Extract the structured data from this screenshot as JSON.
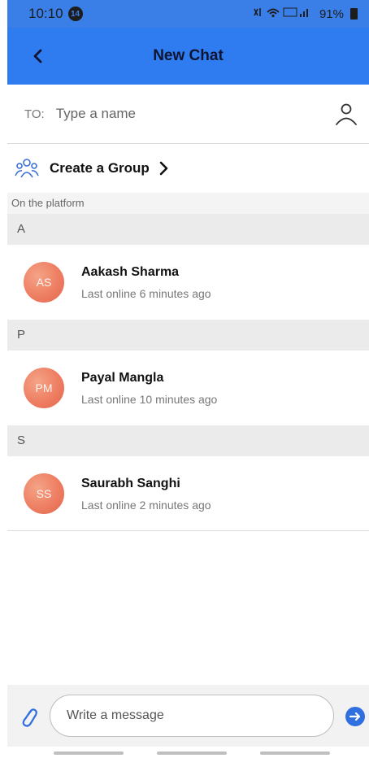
{
  "status_bar": {
    "time": "10:10",
    "notification_badge": "14",
    "indicators": " ◉ ≡ LTE .ll",
    "battery": "91%"
  },
  "app_bar": {
    "title": "New Chat",
    "back_icon": "chevron-left-icon",
    "background": "#2f7bf0"
  },
  "recipient": {
    "to_label": "TO:",
    "placeholder": "Type a name",
    "icon": "person-icon"
  },
  "create_group": {
    "label": "Create a Group",
    "icon": "group-icon",
    "chevron": "chevron-right-icon",
    "icon_color": "#3a6fd8"
  },
  "platform_label": "On the platform",
  "sections": [
    {
      "letter": "A",
      "contacts": [
        {
          "initials": "AS",
          "name": "Aakash Sharma",
          "status": "Last online 6 minutes ago"
        }
      ]
    },
    {
      "letter": "P",
      "contacts": [
        {
          "initials": "PM",
          "name": "Payal Mangla",
          "status": "Last online 10 minutes ago"
        }
      ]
    },
    {
      "letter": "S",
      "contacts": [
        {
          "initials": "SS",
          "name": "Saurabh Sanghi",
          "status": "Last online 2 minutes ago"
        }
      ]
    }
  ],
  "composer": {
    "placeholder": "Write a message",
    "attach_icon": "paperclip-icon",
    "send_icon": "send-arrow-icon",
    "accent": "#2f6fe0"
  }
}
